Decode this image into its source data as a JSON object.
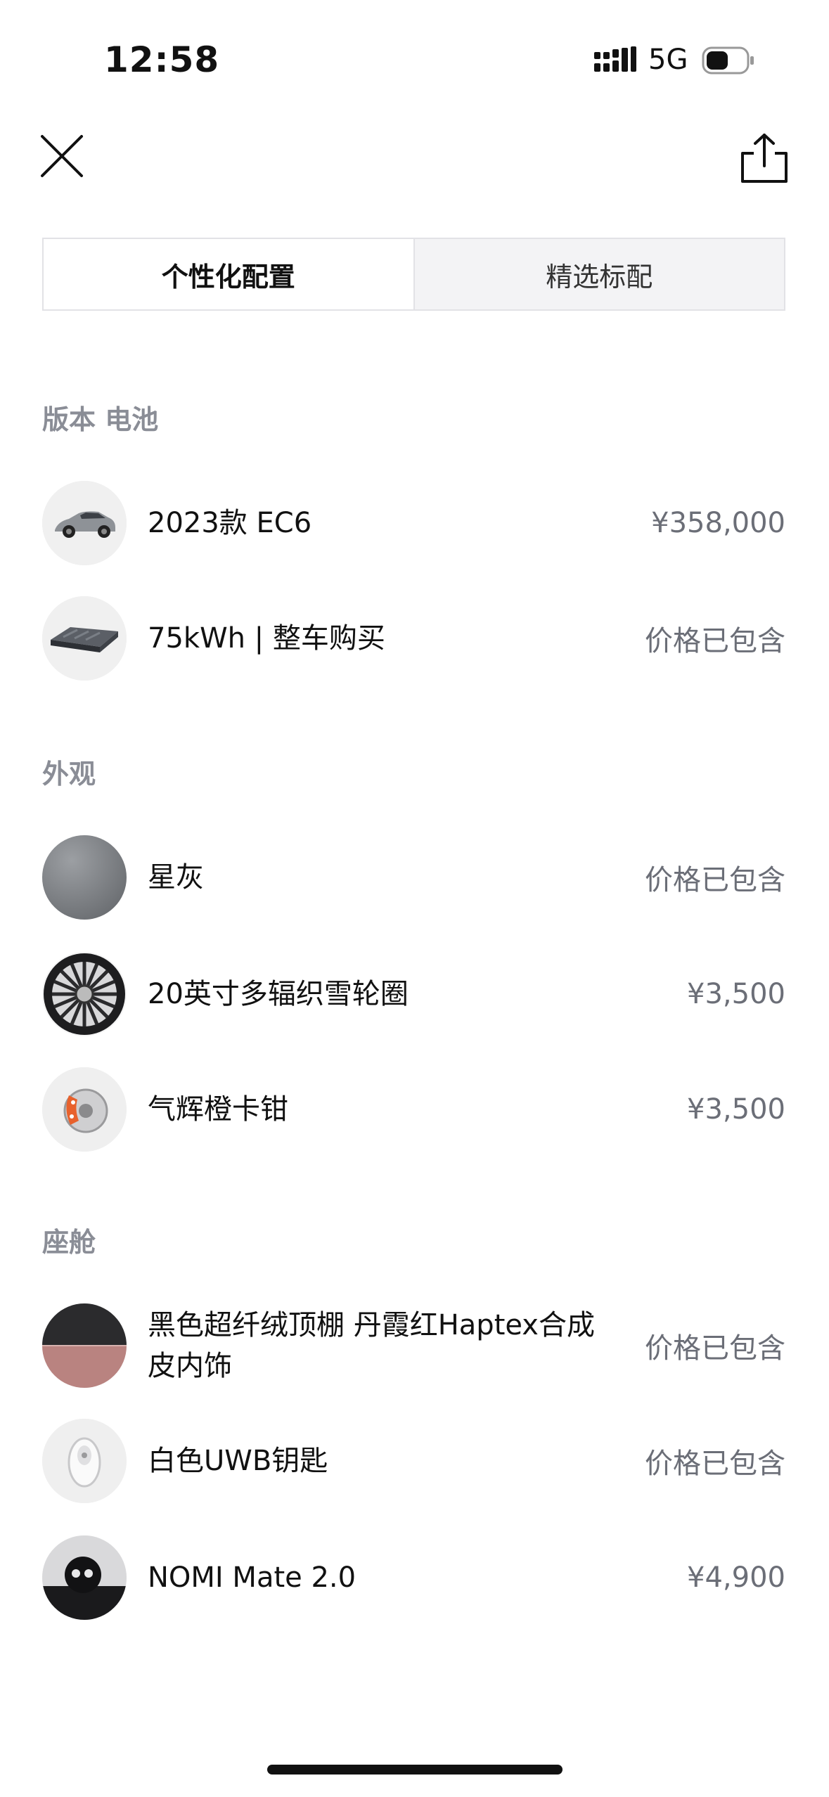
{
  "status_bar": {
    "time": "12:58",
    "network": "5G"
  },
  "tabs": [
    {
      "label": "个性化配置",
      "active": true
    },
    {
      "label": "精选标配",
      "active": false
    }
  ],
  "sections": {
    "version_battery": {
      "title": "版本 电池",
      "items": [
        {
          "label": "2023款 EC6",
          "price": "¥358,000",
          "icon": "car-thumbnail"
        },
        {
          "label": "75kWh | 整车购买",
          "price": "价格已包含",
          "icon": "battery-thumbnail"
        }
      ]
    },
    "exterior": {
      "title": "外观",
      "items": [
        {
          "label": "星灰",
          "price": "价格已包含",
          "icon": "color-swatch-gray"
        },
        {
          "label": "20英寸多辐织雪轮圈",
          "price": "¥3,500",
          "icon": "wheel-thumbnail"
        },
        {
          "label": "气辉橙卡钳",
          "price": "¥3,500",
          "icon": "caliper-thumbnail"
        }
      ]
    },
    "cabin": {
      "title": "座舱",
      "items": [
        {
          "label": "黑色超纤绒顶棚 丹霞红Haptex合成皮内饰",
          "price": "价格已包含",
          "icon": "interior-swatch"
        },
        {
          "label": "白色UWB钥匙",
          "price": "价格已包含",
          "icon": "key-thumbnail"
        },
        {
          "label": "NOMI Mate 2.0",
          "price": "¥4,900",
          "icon": "nomi-thumbnail"
        }
      ]
    }
  },
  "colors": {
    "section_title": "#8a8d96",
    "price_text": "#6b6e77",
    "tab_border": "#e2e2e6",
    "caliper_orange": "#e8612c",
    "interior_red": "#b98380"
  }
}
